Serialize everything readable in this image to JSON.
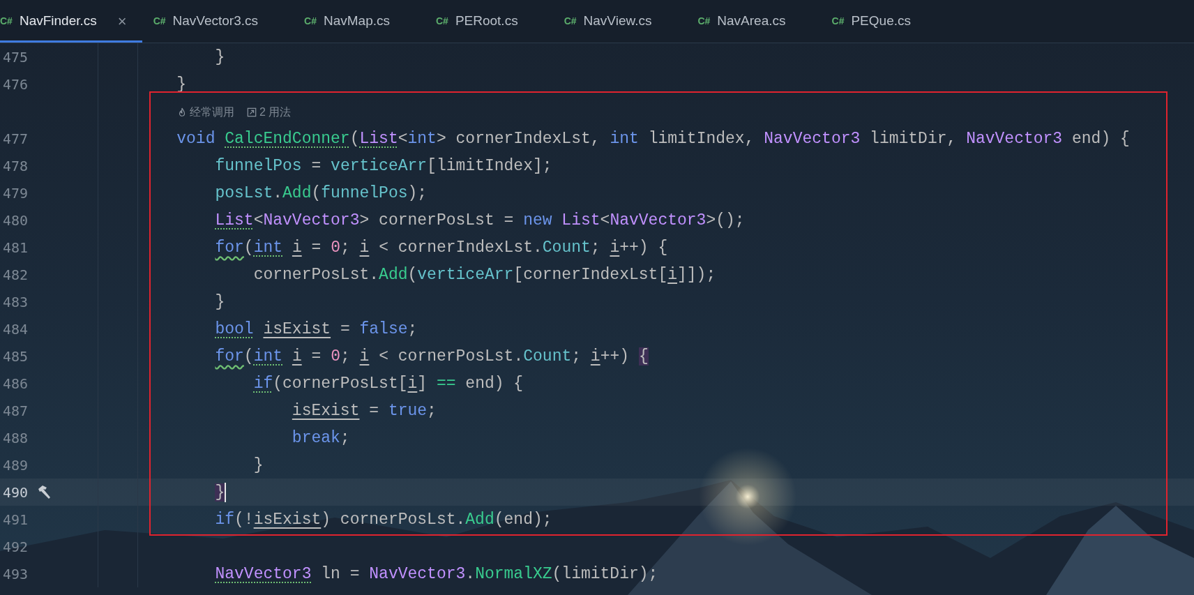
{
  "tabs": [
    {
      "icon_text": "C#",
      "label": "NavFinder.cs",
      "selected": true,
      "close": "×"
    },
    {
      "icon_text": "C#",
      "label": "NavVector3.cs",
      "selected": false
    },
    {
      "icon_text": "C#",
      "label": "NavMap.cs",
      "selected": false
    },
    {
      "icon_text": "C#",
      "label": "PERoot.cs",
      "selected": false
    },
    {
      "icon_text": "C#",
      "label": "NavView.cs",
      "selected": false
    },
    {
      "icon_text": "C#",
      "label": "NavArea.cs",
      "selected": false
    },
    {
      "icon_text": "C#",
      "label": "PEQue.cs",
      "selected": false
    }
  ],
  "lines": [
    {
      "kind": "code",
      "number": "475",
      "current": false,
      "tokens": [
        {
          "text": "        }",
          "kind": "plain"
        }
      ]
    },
    {
      "kind": "code",
      "number": "476",
      "current": false,
      "tokens": [
        {
          "text": "    }",
          "kind": "plain"
        }
      ]
    },
    {
      "kind": "hints",
      "items": [
        {
          "kind": "frequency",
          "text": "经常调用"
        },
        {
          "kind": "usages",
          "text": "2 用法"
        }
      ]
    },
    {
      "kind": "code",
      "number": "477",
      "current": false,
      "tokens": [
        {
          "text": "    void ",
          "kind": "keyword"
        },
        {
          "text": "CalcEndConner",
          "kind": "method",
          "suggestion": true
        },
        {
          "text": "(",
          "kind": "plain"
        },
        {
          "text": "List",
          "kind": "type",
          "suggestion": true
        },
        {
          "text": "<",
          "kind": "plain"
        },
        {
          "text": "int",
          "kind": "keyword"
        },
        {
          "text": "> cornerIndexLst, ",
          "kind": "plain"
        },
        {
          "text": "int",
          "kind": "keyword"
        },
        {
          "text": " limitIndex, ",
          "kind": "plain"
        },
        {
          "text": "NavVector3",
          "kind": "type"
        },
        {
          "text": " limitDir, ",
          "kind": "plain"
        },
        {
          "text": "NavVector3",
          "kind": "type"
        },
        {
          "text": " end) {",
          "kind": "plain"
        }
      ]
    },
    {
      "kind": "code",
      "number": "478",
      "current": false,
      "tokens": [
        {
          "text": "        funnelPos",
          "kind": "field"
        },
        {
          "text": " = ",
          "kind": "plain"
        },
        {
          "text": "verticeArr",
          "kind": "field"
        },
        {
          "text": "[limitIndex];",
          "kind": "plain"
        }
      ]
    },
    {
      "kind": "code",
      "number": "479",
      "current": false,
      "tokens": [
        {
          "text": "        posLst",
          "kind": "field"
        },
        {
          "text": ".",
          "kind": "plain"
        },
        {
          "text": "Add",
          "kind": "method"
        },
        {
          "text": "(",
          "kind": "plain"
        },
        {
          "text": "funnelPos",
          "kind": "field"
        },
        {
          "text": ");",
          "kind": "plain"
        }
      ]
    },
    {
      "kind": "code",
      "number": "480",
      "current": false,
      "tokens": [
        {
          "text": "        List",
          "kind": "type",
          "suggestion": true
        },
        {
          "text": "<",
          "kind": "plain"
        },
        {
          "text": "NavVector3",
          "kind": "type"
        },
        {
          "text": "> cornerPosLst = ",
          "kind": "plain"
        },
        {
          "text": "new ",
          "kind": "keyword"
        },
        {
          "text": "List",
          "kind": "type"
        },
        {
          "text": "<",
          "kind": "plain"
        },
        {
          "text": "NavVector3",
          "kind": "type"
        },
        {
          "text": ">();",
          "kind": "plain"
        }
      ]
    },
    {
      "kind": "code",
      "number": "481",
      "current": false,
      "tokens": [
        {
          "text": "        for",
          "kind": "keyword",
          "typo": true
        },
        {
          "text": "(",
          "kind": "plain"
        },
        {
          "text": "int",
          "kind": "keyword",
          "suggestion": true
        },
        {
          "text": " i",
          "kind": "local"
        },
        {
          "text": " = ",
          "kind": "plain"
        },
        {
          "text": "0",
          "kind": "number"
        },
        {
          "text": "; ",
          "kind": "plain"
        },
        {
          "text": "i",
          "kind": "local"
        },
        {
          "text": " < cornerIndexLst.",
          "kind": "plain"
        },
        {
          "text": "Count",
          "kind": "field"
        },
        {
          "text": "; ",
          "kind": "plain"
        },
        {
          "text": "i",
          "kind": "local"
        },
        {
          "text": "++) {",
          "kind": "plain"
        }
      ]
    },
    {
      "kind": "code",
      "number": "482",
      "current": false,
      "tokens": [
        {
          "text": "            cornerPosLst.",
          "kind": "plain"
        },
        {
          "text": "Add",
          "kind": "method"
        },
        {
          "text": "(",
          "kind": "plain"
        },
        {
          "text": "verticeArr",
          "kind": "field"
        },
        {
          "text": "[cornerIndexLst[",
          "kind": "plain"
        },
        {
          "text": "i",
          "kind": "local"
        },
        {
          "text": "]]);",
          "kind": "plain"
        }
      ]
    },
    {
      "kind": "code",
      "number": "483",
      "current": false,
      "tokens": [
        {
          "text": "        }",
          "kind": "plain"
        }
      ]
    },
    {
      "kind": "code",
      "number": "484",
      "current": false,
      "tokens": [
        {
          "text": "        bool",
          "kind": "keyword",
          "suggestion": true
        },
        {
          "text": " isExist",
          "kind": "local"
        },
        {
          "text": " = ",
          "kind": "plain"
        },
        {
          "text": "false",
          "kind": "keyword"
        },
        {
          "text": ";",
          "kind": "plain"
        }
      ]
    },
    {
      "kind": "code",
      "number": "485",
      "current": false,
      "tokens": [
        {
          "text": "        for",
          "kind": "keyword",
          "typo": true
        },
        {
          "text": "(",
          "kind": "plain"
        },
        {
          "text": "int",
          "kind": "keyword",
          "suggestion": true
        },
        {
          "text": " i",
          "kind": "local"
        },
        {
          "text": " = ",
          "kind": "plain"
        },
        {
          "text": "0",
          "kind": "number"
        },
        {
          "text": "; ",
          "kind": "plain"
        },
        {
          "text": "i",
          "kind": "local"
        },
        {
          "text": " < cornerPosLst.",
          "kind": "plain"
        },
        {
          "text": "Count",
          "kind": "field"
        },
        {
          "text": "; ",
          "kind": "plain"
        },
        {
          "text": "i",
          "kind": "local"
        },
        {
          "text": "++) ",
          "kind": "plain"
        },
        {
          "text": "{",
          "kind": "plain",
          "match": true
        }
      ]
    },
    {
      "kind": "code",
      "number": "486",
      "current": false,
      "tokens": [
        {
          "text": "            if",
          "kind": "keyword",
          "suggestion": true
        },
        {
          "text": "(cornerPosLst[",
          "kind": "plain"
        },
        {
          "text": "i",
          "kind": "local"
        },
        {
          "text": "] ",
          "kind": "plain"
        },
        {
          "text": "==",
          "kind": "operator"
        },
        {
          "text": " end) {",
          "kind": "plain"
        }
      ]
    },
    {
      "kind": "code",
      "number": "487",
      "current": false,
      "tokens": [
        {
          "text": "                isExist",
          "kind": "local"
        },
        {
          "text": " = ",
          "kind": "plain"
        },
        {
          "text": "true",
          "kind": "keyword"
        },
        {
          "text": ";",
          "kind": "plain"
        }
      ]
    },
    {
      "kind": "code",
      "number": "488",
      "current": false,
      "tokens": [
        {
          "text": "                break",
          "kind": "keyword"
        },
        {
          "text": ";",
          "kind": "plain"
        }
      ]
    },
    {
      "kind": "code",
      "number": "489",
      "current": false,
      "tokens": [
        {
          "text": "            }",
          "kind": "plain"
        }
      ]
    },
    {
      "kind": "code",
      "number": "490",
      "current": true,
      "build_marker": true,
      "tokens": [
        {
          "text": "        }",
          "kind": "plain",
          "match": true
        }
      ]
    },
    {
      "kind": "code",
      "number": "491",
      "current": false,
      "tokens": [
        {
          "text": "        if",
          "kind": "keyword"
        },
        {
          "text": "(!",
          "kind": "plain"
        },
        {
          "text": "isExist",
          "kind": "local"
        },
        {
          "text": ") cornerPosLst.",
          "kind": "plain"
        },
        {
          "text": "Add",
          "kind": "method"
        },
        {
          "text": "(end);",
          "kind": "plain"
        }
      ]
    },
    {
      "kind": "code",
      "number": "492",
      "current": false
    },
    {
      "kind": "code",
      "number": "493",
      "current": false,
      "tokens": [
        {
          "text": "        NavVector3",
          "kind": "type",
          "suggestion": true
        },
        {
          "text": " ln = ",
          "kind": "plain"
        },
        {
          "text": "NavVector3",
          "kind": "type"
        },
        {
          "text": ".",
          "kind": "plain"
        },
        {
          "text": "NormalXZ",
          "kind": "method"
        },
        {
          "text": "(limitDir);",
          "kind": "plain"
        }
      ]
    }
  ]
}
